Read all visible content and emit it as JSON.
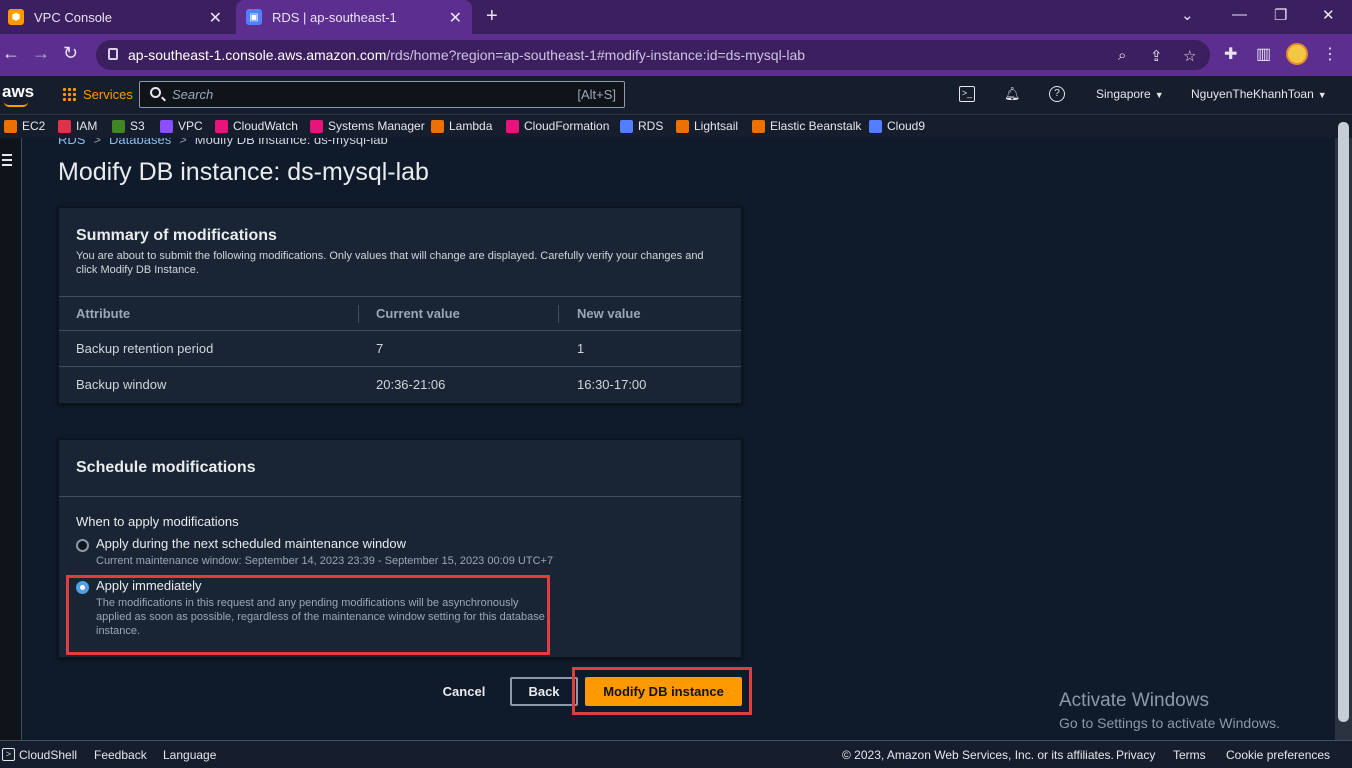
{
  "browser": {
    "tabs": [
      {
        "label": "VPC Console",
        "active": false,
        "favicon_color": "#ff9900"
      },
      {
        "label": "RDS | ap-southeast-1",
        "active": true,
        "favicon_color": "#527fff"
      }
    ],
    "url_domain": "ap-southeast-1.console.aws.amazon.com",
    "url_path": "/rds/home?region=ap-southeast-1#modify-instance:id=ds-mysql-lab"
  },
  "aws_header": {
    "logo": "aws",
    "services_label": "Services",
    "search_placeholder": "Search",
    "search_shortcut": "[Alt+S]",
    "region": "Singapore",
    "account": "NguyenTheKhanhToan"
  },
  "favorites": [
    {
      "label": "EC2",
      "color": "#ed7100"
    },
    {
      "label": "IAM",
      "color": "#dd344c"
    },
    {
      "label": "S3",
      "color": "#3f8624"
    },
    {
      "label": "VPC",
      "color": "#8c4fff"
    },
    {
      "label": "CloudWatch",
      "color": "#e7157b"
    },
    {
      "label": "Systems Manager",
      "color": "#e7157b"
    },
    {
      "label": "Lambda",
      "color": "#ed7100"
    },
    {
      "label": "CloudFormation",
      "color": "#e7157b"
    },
    {
      "label": "RDS",
      "color": "#527fff"
    },
    {
      "label": "Lightsail",
      "color": "#ed7100"
    },
    {
      "label": "Elastic Beanstalk",
      "color": "#ed7100"
    },
    {
      "label": "Cloud9",
      "color": "#527fff"
    }
  ],
  "breadcrumb": {
    "root": "RDS",
    "parent": "Databases",
    "current": "Modify DB instance: ds-mysql-lab"
  },
  "page_title": "Modify DB instance: ds-mysql-lab",
  "summary": {
    "title": "Summary of modifications",
    "description": "You are about to submit the following modifications. Only values that will change are displayed. Carefully verify your changes and click Modify DB Instance.",
    "columns": [
      "Attribute",
      "Current value",
      "New value"
    ],
    "rows": [
      [
        "Backup retention period",
        "7",
        "1"
      ],
      [
        "Backup window",
        "20:36-21:06",
        "16:30-17:00"
      ]
    ]
  },
  "schedule": {
    "title": "Schedule modifications",
    "label": "When to apply modifications",
    "options": [
      {
        "title": "Apply during the next scheduled maintenance window",
        "desc": "Current maintenance window: September 14, 2023 23:39 - September 15, 2023 00:09 UTC+7",
        "selected": false
      },
      {
        "title": "Apply immediately",
        "desc": "The modifications in this request and any pending modifications will be asynchronously applied as soon as possible, regardless of the maintenance window setting for this database instance.",
        "selected": true
      }
    ]
  },
  "actions": {
    "cancel": "Cancel",
    "back": "Back",
    "submit": "Modify DB instance"
  },
  "watermark": {
    "line1": "Activate Windows",
    "line2": "Go to Settings to activate Windows."
  },
  "footer": {
    "cloudshell": "CloudShell",
    "feedback": "Feedback",
    "language": "Language",
    "copyright": "© 2023, Amazon Web Services, Inc. or its affiliates.",
    "privacy": "Privacy",
    "terms": "Terms",
    "cookies": "Cookie preferences"
  }
}
